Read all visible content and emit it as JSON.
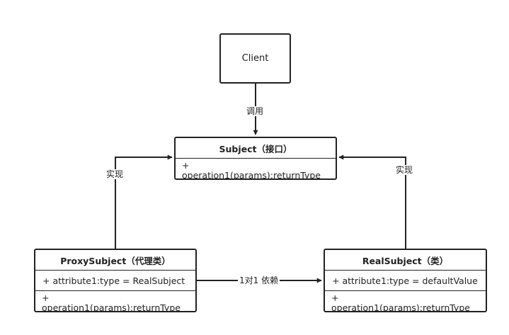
{
  "client": {
    "label": "Client"
  },
  "subject": {
    "title": "Subject（接口）",
    "op_line1": "+",
    "op_line2": "operation1(params):returnType"
  },
  "proxy": {
    "title": "ProxySubject（代理类）",
    "attribute": "+ attribute1:type = RealSubject",
    "op_line1": "+",
    "op_line2": "operation1(params):returnType"
  },
  "real": {
    "title": "RealSubject（类）",
    "attribute": "+ attribute1:type = defaultValue",
    "op_line1": "+",
    "op_line2": "operation1(params):returnType"
  },
  "edges": {
    "call": "调用",
    "impl_left": "实现",
    "impl_right": "实现",
    "dependency": "1对1 依赖"
  },
  "colors": {
    "line": "#222222",
    "background": "#ffffff"
  }
}
